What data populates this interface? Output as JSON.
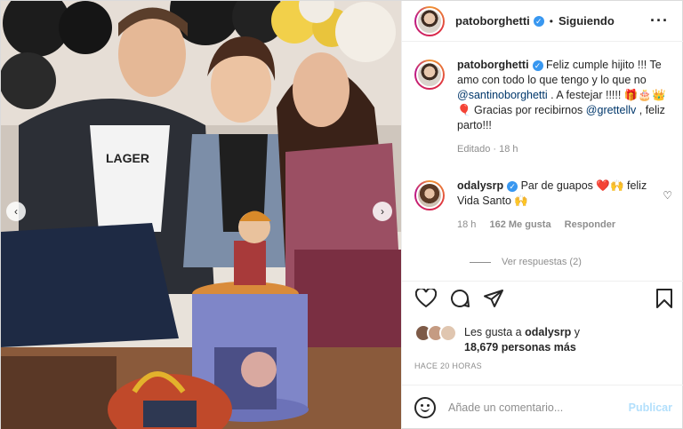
{
  "header": {
    "username": "patoborghetti",
    "verified_icon": "verified-badge-icon",
    "separator": "•",
    "follow_status": "Siguiendo",
    "more_icon": "more-options-icon",
    "more_glyph": "···"
  },
  "caption": {
    "username": "patoborghetti",
    "text_1": "Feliz cumple hijito !!! Te amo con todo lo que tengo y lo que no",
    "mention_1": "@santinoborghetti",
    "text_2": ". A festejar !!!!! 🎁🎂👑🎈 Gracias por recibirnos",
    "mention_2": "@grettellv",
    "text_3": ", feliz parto!!!",
    "edited": "Editado",
    "time": "18 h"
  },
  "comment": {
    "username": "odalysrp",
    "text": "Par de guapos ❤️🙌 feliz Vida Santo 🙌",
    "time": "18 h",
    "likes": "162 Me gusta",
    "reply": "Responder",
    "like_glyph": "♡",
    "view_replies": "Ver respuestas (2)"
  },
  "actions": {
    "like_icon": "heart-icon",
    "comment_icon": "comment-icon",
    "share_icon": "share-icon",
    "save_icon": "bookmark-icon"
  },
  "likes": {
    "line_1": "Les gusta a",
    "user": "odalysrp",
    "line_1_end": "y",
    "line_2": "18,679 personas más"
  },
  "timestamp": "HACE 20 HORAS",
  "composer": {
    "placeholder": "Añade un comentario...",
    "publish": "Publicar"
  },
  "photo": {
    "prev_glyph": "‹",
    "next_glyph": "›",
    "shirt_text": "LAGER"
  },
  "colors": {
    "accent_blue": "#3897f0",
    "link": "#00376b",
    "muted": "#8e8e8e",
    "publish_disabled": "#b2dffc"
  }
}
